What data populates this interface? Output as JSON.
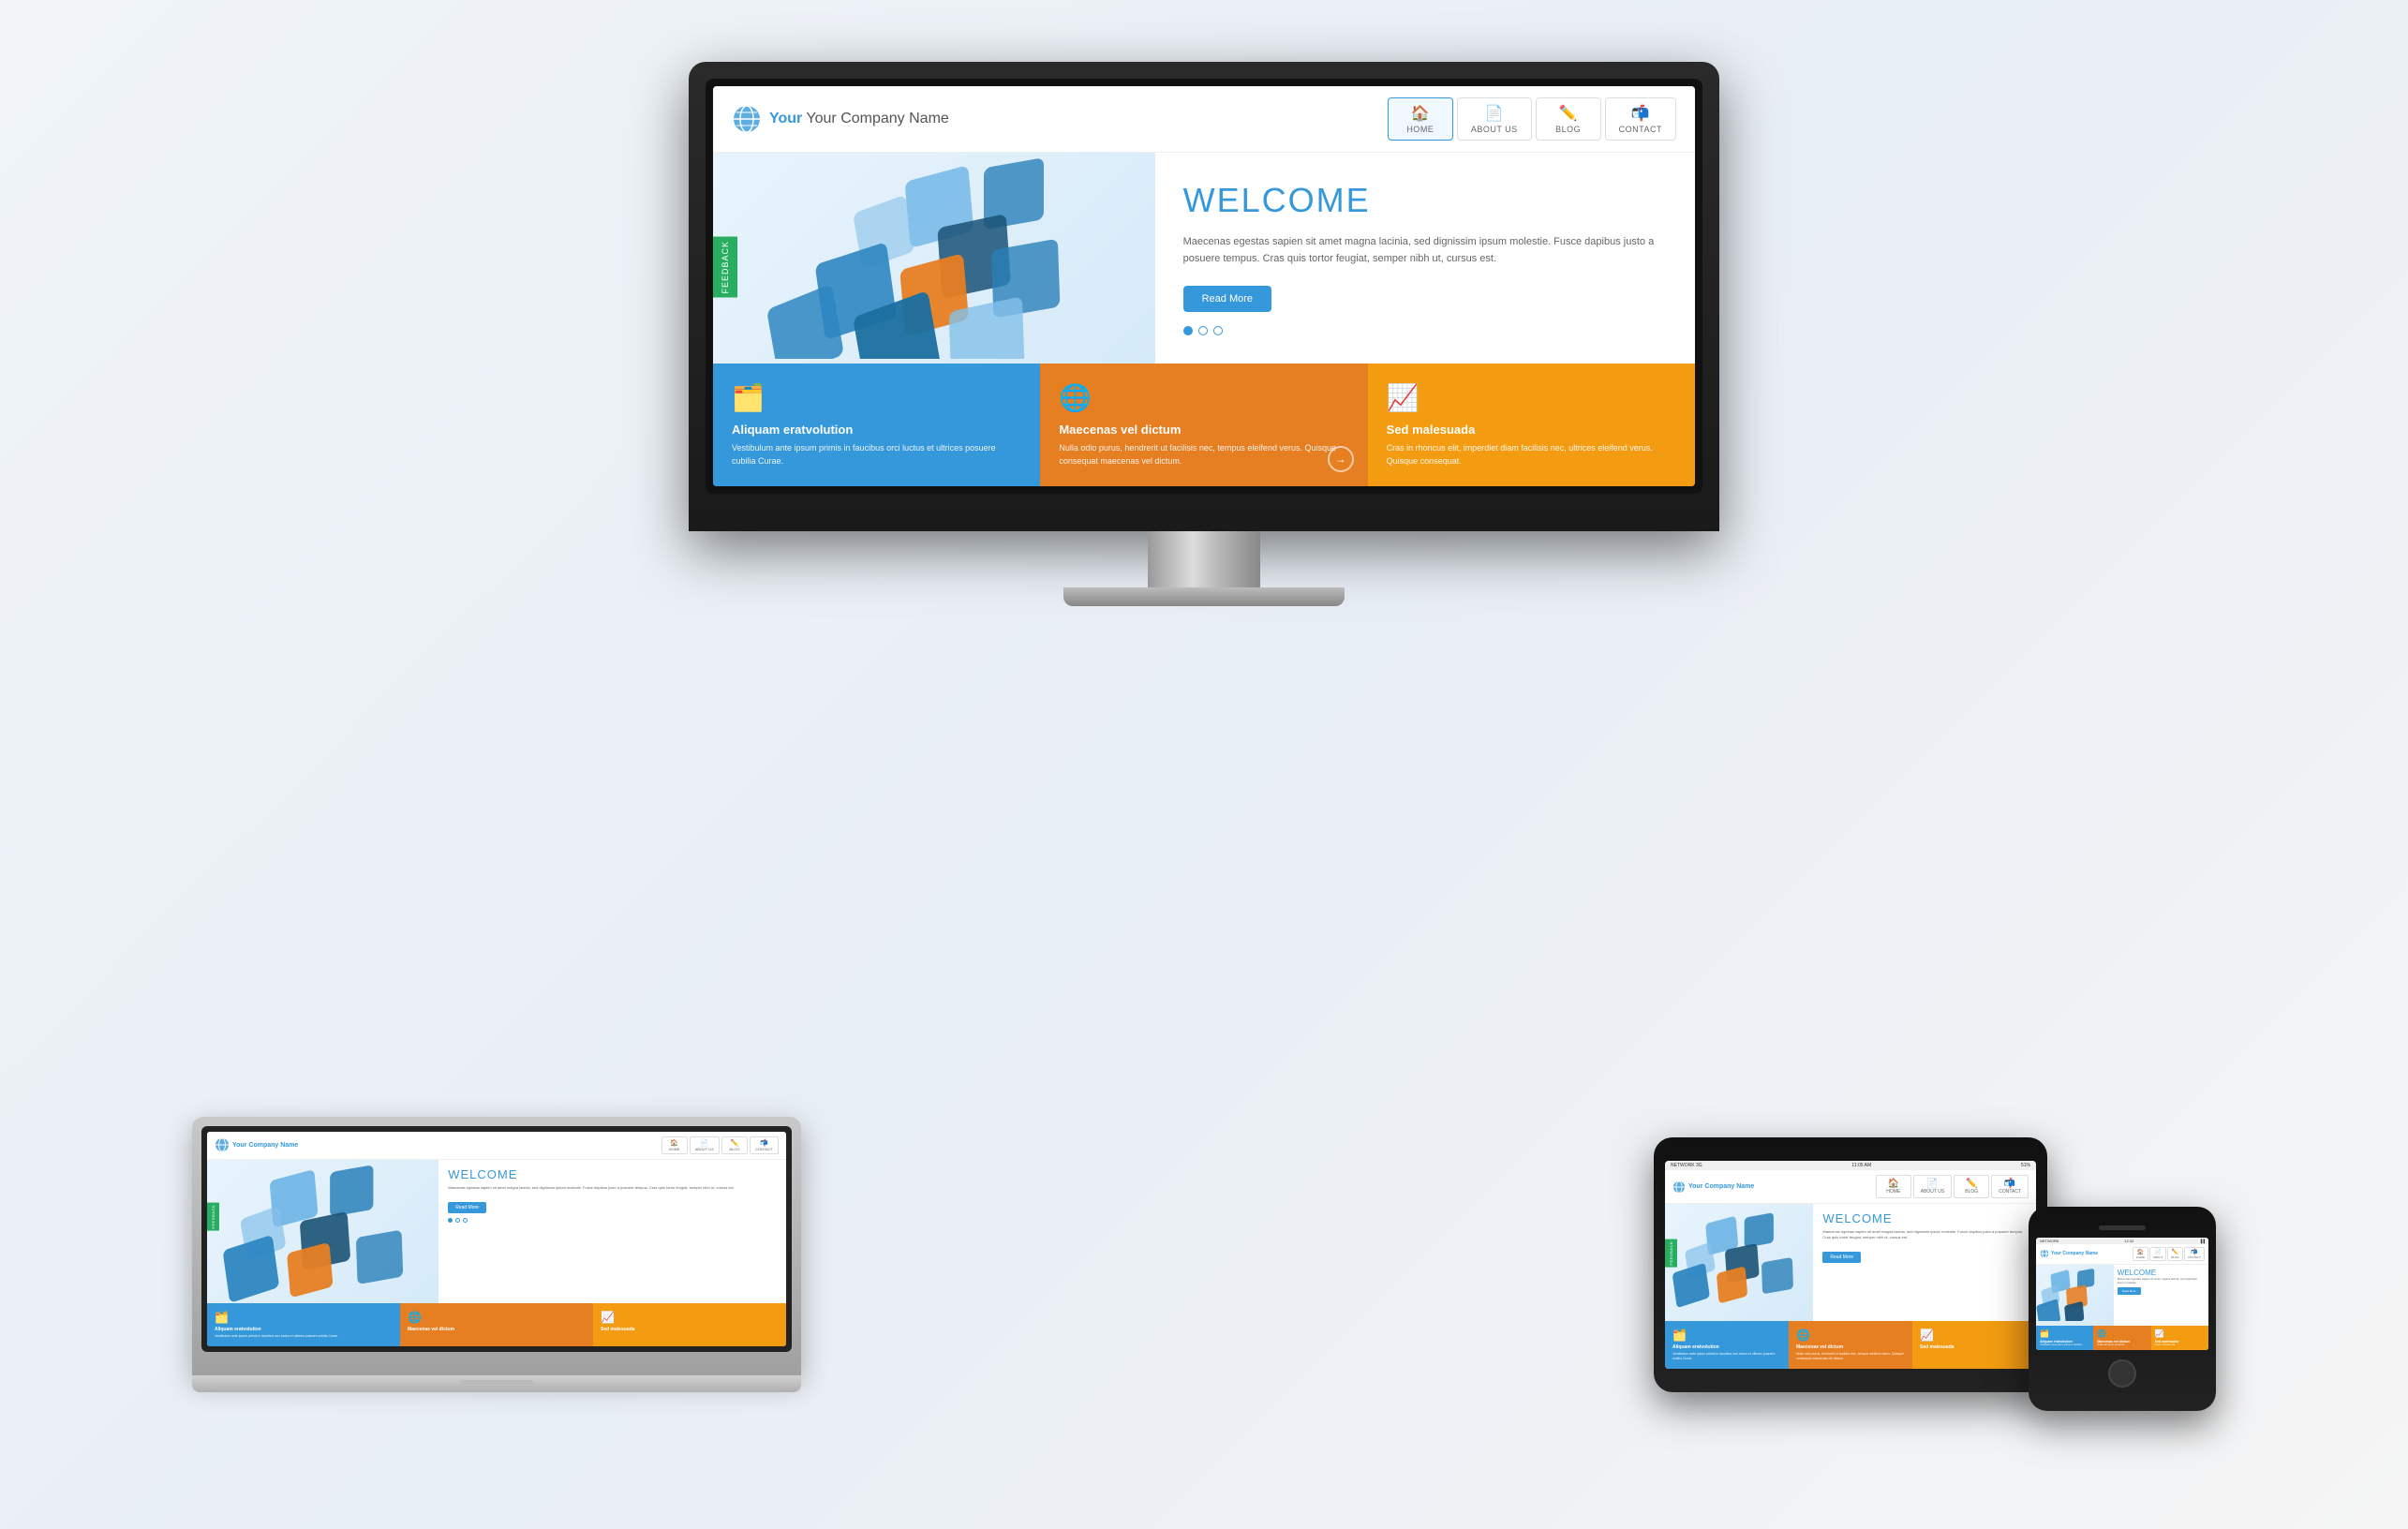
{
  "page": {
    "background": "#f0f4f8"
  },
  "website": {
    "logo": {
      "text": "Your Company Name",
      "highlight": "Your"
    },
    "nav": {
      "items": [
        {
          "label": "HOME",
          "icon": "🏠",
          "class": "nav-home",
          "active": true
        },
        {
          "label": "ABOUT US",
          "icon": "📄",
          "class": "nav-about",
          "active": false
        },
        {
          "label": "BLOG",
          "icon": "✏️",
          "class": "nav-blog",
          "active": false
        },
        {
          "label": "CONTACT",
          "icon": "📬",
          "class": "nav-contact",
          "active": false
        }
      ]
    },
    "hero": {
      "title": "WELCOME",
      "text": "Maecenas egestas sapien sit amet magna lacinia, sed dignissim ipsum molestie. Fusce dapibus justo a posuere tempus. Cras quis tortor feugiat, semper nibh ut, cursus est.",
      "button": "Read More",
      "feedback_tab": "FEEDBACK"
    },
    "cards": [
      {
        "color": "blue",
        "icon": "🗂️",
        "title": "Aliquam eratvolution",
        "text": "Vestibulum ante ipsum primis in faucibus orci luctus et ultrices posuere cubilia Curae."
      },
      {
        "color": "orange",
        "icon": "🌐",
        "title": "Maecenas vel dictum",
        "text": "Nulla odio purus, hendrerit ut facilisis nec, tempus eleifend verus. Quisque consequat maecenas vel dictum."
      },
      {
        "color": "yellow",
        "icon": "📈",
        "title": "Sed malesuada",
        "text": "Cras in rhoncus elit, imperdiet diam facilisis nec, ultrices eleifend verus. Quisque consequat."
      }
    ],
    "dots": [
      {
        "active": true
      },
      {
        "active": false
      },
      {
        "active": false
      }
    ]
  },
  "devices": {
    "monitor": {
      "label": "Desktop Monitor"
    },
    "laptop": {
      "label": "Laptop"
    },
    "tablet": {
      "label": "Tablet",
      "status": {
        "network": "NETWORK 3G",
        "time": "11:05 AM",
        "battery": "51%"
      }
    },
    "phone": {
      "label": "Smartphone",
      "status": {
        "network": "NETWORK",
        "time": "12:32",
        "battery": "▐▐"
      }
    }
  }
}
